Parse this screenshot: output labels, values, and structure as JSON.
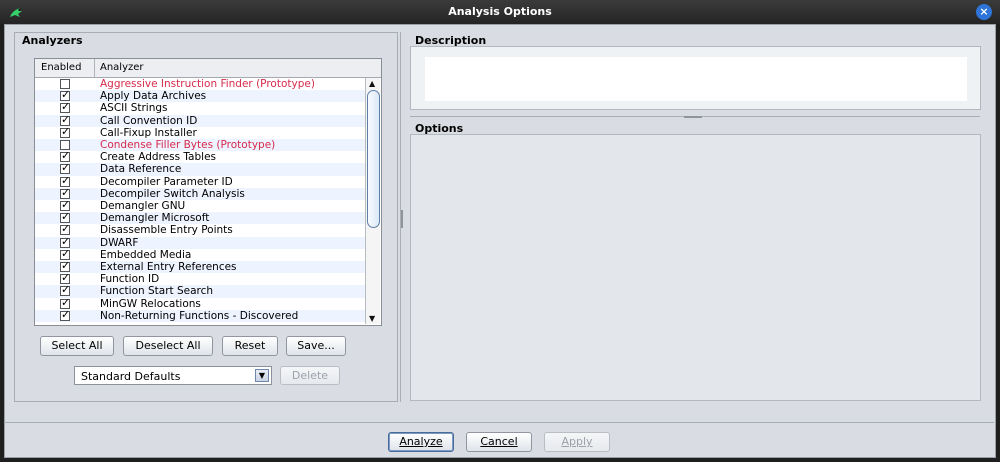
{
  "window": {
    "title": "Analysis Options",
    "app_icon": "dragon-icon",
    "close_icon": "close-icon"
  },
  "analyzers": {
    "section_title": "Analyzers",
    "headers": {
      "enabled": "Enabled",
      "analyzer": "Analyzer"
    },
    "rows": [
      {
        "label": "Aggressive Instruction Finder (Prototype)",
        "enabled": false,
        "prototype": true
      },
      {
        "label": "Apply Data Archives",
        "enabled": true,
        "prototype": false
      },
      {
        "label": "ASCII Strings",
        "enabled": true,
        "prototype": false
      },
      {
        "label": "Call Convention ID",
        "enabled": true,
        "prototype": false
      },
      {
        "label": "Call-Fixup Installer",
        "enabled": true,
        "prototype": false
      },
      {
        "label": "Condense Filler Bytes (Prototype)",
        "enabled": false,
        "prototype": true
      },
      {
        "label": "Create Address Tables",
        "enabled": true,
        "prototype": false
      },
      {
        "label": "Data Reference",
        "enabled": true,
        "prototype": false
      },
      {
        "label": "Decompiler Parameter ID",
        "enabled": true,
        "prototype": false
      },
      {
        "label": "Decompiler Switch Analysis",
        "enabled": true,
        "prototype": false
      },
      {
        "label": "Demangler GNU",
        "enabled": true,
        "prototype": false
      },
      {
        "label": "Demangler Microsoft",
        "enabled": true,
        "prototype": false
      },
      {
        "label": "Disassemble Entry Points",
        "enabled": true,
        "prototype": false
      },
      {
        "label": "DWARF",
        "enabled": true,
        "prototype": false
      },
      {
        "label": "Embedded Media",
        "enabled": true,
        "prototype": false
      },
      {
        "label": "External Entry References",
        "enabled": true,
        "prototype": false
      },
      {
        "label": "Function ID",
        "enabled": true,
        "prototype": false
      },
      {
        "label": "Function Start Search",
        "enabled": true,
        "prototype": false
      },
      {
        "label": "MinGW Relocations",
        "enabled": true,
        "prototype": false
      },
      {
        "label": "Non-Returning Functions - Discovered",
        "enabled": true,
        "prototype": false
      }
    ]
  },
  "buttons": {
    "select_all": "Select All",
    "deselect_all": "Deselect All",
    "reset": "Reset",
    "save": "Save...",
    "delete": "Delete"
  },
  "profile": {
    "selected": "Standard Defaults"
  },
  "right_panel": {
    "description_title": "Description",
    "options_title": "Options"
  },
  "footer": {
    "analyze": "Analyze",
    "cancel": "Cancel",
    "apply": "Apply"
  }
}
